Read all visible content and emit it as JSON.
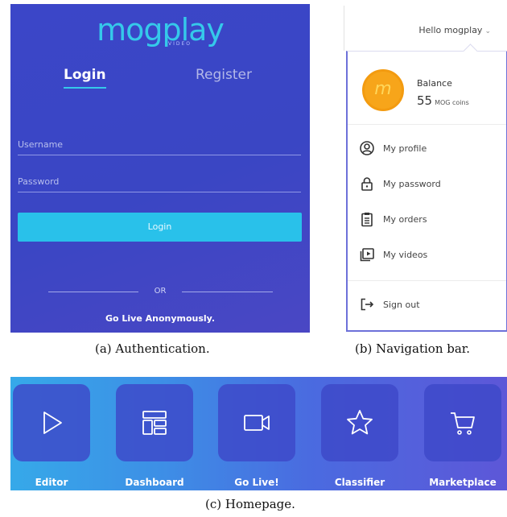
{
  "auth": {
    "logo": "mogplay",
    "logo_sub": "VIDEO",
    "tabs": {
      "login": "Login",
      "register": "Register"
    },
    "username_placeholder": "Username",
    "password_placeholder": "Password",
    "login_button": "Login",
    "or_text": "OR",
    "anonymous_link": "Go Live Anonymously.",
    "caption": "(a) Authentication."
  },
  "nav": {
    "greeting": "Hello mogplay",
    "coin_letter": "m",
    "balance_label": "Balance",
    "balance_value": "55",
    "balance_unit": "MOG coins",
    "items": [
      {
        "label": "My profile",
        "icon": "user-circle-icon"
      },
      {
        "label": "My password",
        "icon": "lock-icon"
      },
      {
        "label": "My orders",
        "icon": "clipboard-icon"
      },
      {
        "label": "My videos",
        "icon": "video-library-icon"
      }
    ],
    "sign_out": "Sign out",
    "caption": "(b) Navigation bar."
  },
  "home": {
    "tiles": [
      {
        "label": "Editor",
        "icon": "play-icon"
      },
      {
        "label": "Dashboard",
        "icon": "dashboard-icon"
      },
      {
        "label": "Go Live!",
        "icon": "video-camera-icon"
      },
      {
        "label": "Classifier",
        "icon": "star-icon"
      },
      {
        "label": "Marketplace",
        "icon": "cart-icon"
      }
    ],
    "caption": "(c) Homepage."
  },
  "colors": {
    "auth_bg": "#3b46c8",
    "accent_cyan": "#29c1ea",
    "nav_border": "#6d71d9",
    "coin": "#f7a51a",
    "tile_bg": "#3d48c8"
  }
}
